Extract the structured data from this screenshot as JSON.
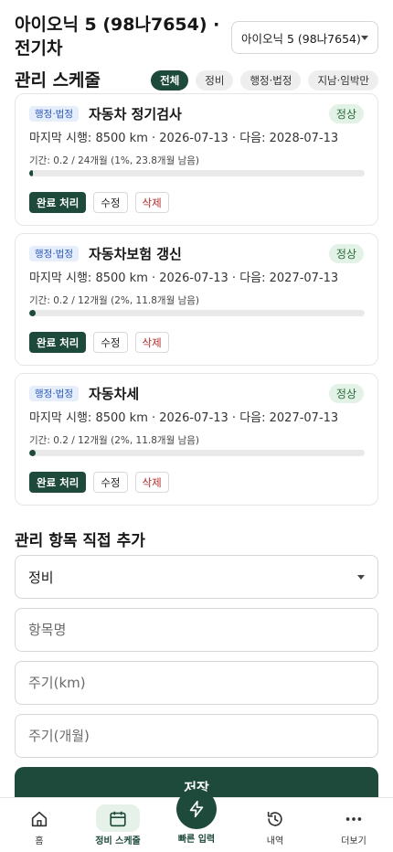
{
  "header": {
    "title": "아이오닉 5 (98나7654) · 전기차",
    "vehicle_select": "아이오닉 5 (98나7654)"
  },
  "schedule": {
    "title": "관리 스케줄",
    "filters": [
      "전체",
      "정비",
      "행정·법정",
      "지남·임박만"
    ],
    "active_filter": "전체"
  },
  "items": [
    {
      "category": "행정·법정",
      "name": "자동차 정기검사",
      "status": "정상",
      "meta": "마지막 시행: 8500 km · 2026-07-13 · 다음: 2028-07-13",
      "period": "기간: 0.2 / 24개월 (1%, 23.8개월 남음)",
      "progress": 0.01,
      "actions": [
        "완료 처리",
        "수정",
        "삭제"
      ]
    },
    {
      "category": "행정·법정",
      "name": "자동차보험 갱신",
      "status": "정상",
      "meta": "마지막 시행: 8500 km · 2026-07-13 · 다음: 2027-07-13",
      "period": "기간: 0.2 / 12개월 (2%, 11.8개월 남음)",
      "progress": 0.02,
      "actions": [
        "완료 처리",
        "수정",
        "삭제"
      ]
    },
    {
      "category": "행정·법정",
      "name": "자동차세",
      "status": "정상",
      "meta": "마지막 시행: 8500 km · 2026-07-13 · 다음: 2027-07-13",
      "period": "기간: 0.2 / 12개월 (2%, 11.8개월 남음)",
      "progress": 0.02,
      "actions": [
        "완료 처리",
        "수정",
        "삭제"
      ]
    }
  ],
  "add_form": {
    "title": "관리 항목 직접 추가",
    "category_value": "정비",
    "name_placeholder": "항목명",
    "km_placeholder": "주기(km)",
    "months_placeholder": "주기(개월)",
    "save_label": "저장"
  },
  "nav": {
    "home": "홈",
    "schedule": "정비 스케줄",
    "quick": "빠른 입력",
    "history": "내역",
    "more": "더보기"
  },
  "colors": {
    "primary": "#1d4a3a",
    "badge_bg": "#e6eefc",
    "status_bg": "#e3f2e6",
    "danger": "#b02a2a"
  }
}
